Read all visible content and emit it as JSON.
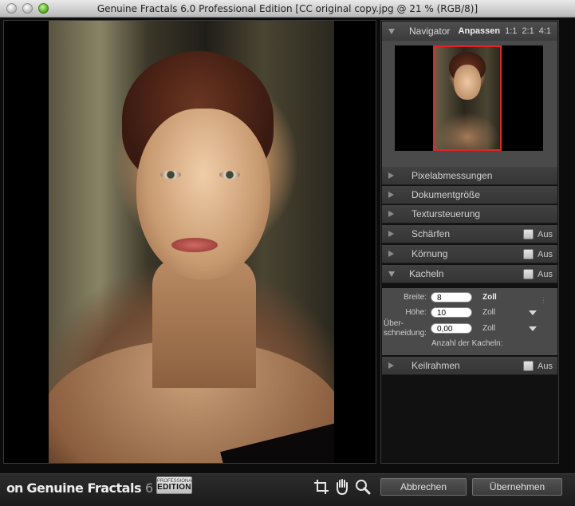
{
  "window": {
    "title": "Genuine Fractals 6.0 Professional Edition [CC original copy.jpg @ 21 % (RGB/8)]"
  },
  "navigator": {
    "label": "Navigator",
    "fit_label": "Anpassen",
    "zoom_1_label": "1:1",
    "zoom_2_label": "2:1",
    "zoom_4_label": "4:1"
  },
  "sections": {
    "pixel": {
      "label": "Pixelabmessungen"
    },
    "document": {
      "label": "Dokumentgröße"
    },
    "texture": {
      "label": "Textursteuerung"
    },
    "sharpen": {
      "label": "Schärfen",
      "state": "Aus"
    },
    "grain": {
      "label": "Körnung",
      "state": "Aus"
    },
    "tiles": {
      "label": "Kacheln",
      "state": "Aus"
    },
    "frame": {
      "label": "Keilrahmen",
      "state": "Aus"
    }
  },
  "tiles": {
    "width_label": "Breite:",
    "width_value": "8",
    "width_unit": "Zoll",
    "height_label": "Höhe:",
    "height_value": "10",
    "height_unit": "Zoll",
    "overlap_label_1": "Über-",
    "overlap_label_2": "schneidung:",
    "overlap_value": "0,00",
    "overlap_unit": "Zoll",
    "count_label": "Anzahl der Kacheln:"
  },
  "brand": {
    "on_one": "on",
    "name": "Genuine Fractals",
    "version": "6",
    "badge_top": "PROFESSIONAL",
    "badge_bottom": "EDITION"
  },
  "buttons": {
    "cancel": "Abbrechen",
    "apply": "Übernehmen"
  },
  "icons": {
    "crop": "crop-icon",
    "hand": "hand-icon",
    "zoom": "zoom-icon"
  }
}
